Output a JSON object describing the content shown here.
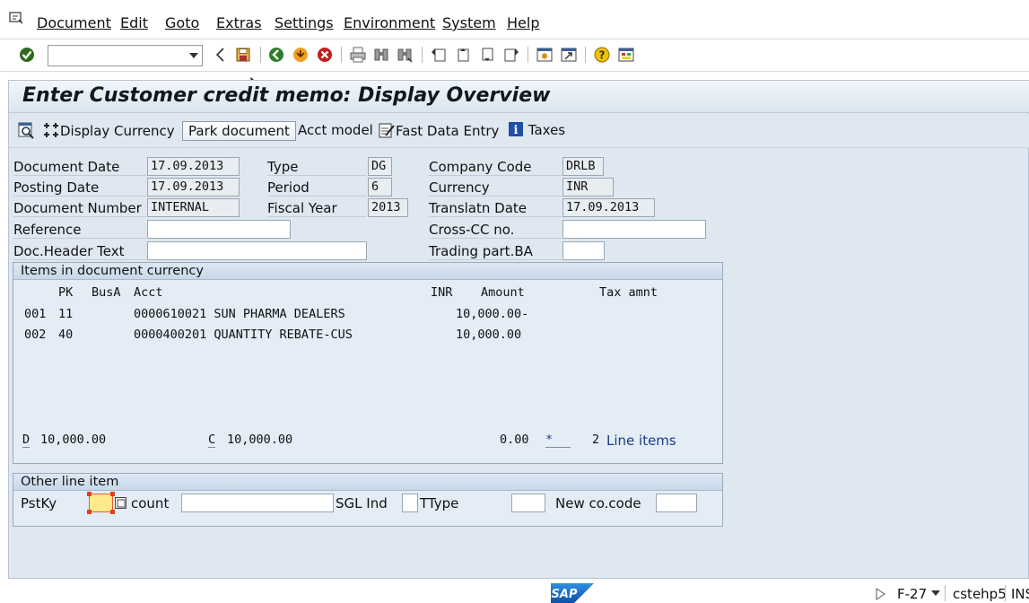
{
  "menu": {
    "items": [
      {
        "label": "Document"
      },
      {
        "label": "Edit"
      },
      {
        "label": "Goto"
      },
      {
        "label": "Extras"
      },
      {
        "label": "Settings"
      },
      {
        "label": "Environment"
      },
      {
        "label": "System"
      },
      {
        "label": "Help"
      }
    ]
  },
  "toolbar": {
    "command_value": "",
    "icons": [
      "enter-check-icon",
      "back-arrow-icon",
      "save-icon",
      "back-icon",
      "exit-icon",
      "cancel-icon",
      "print-icon",
      "find-icon",
      "find-next-icon",
      "first-page-icon",
      "previous-page-icon",
      "next-page-icon",
      "last-page-icon",
      "create-session-icon",
      "shortcut-icon",
      "help-icon",
      "customize-layout-icon"
    ]
  },
  "page": {
    "title": "Enter Customer credit memo: Display Overview"
  },
  "app_toolbar": {
    "display_currency": "Display Currency",
    "park_document": "Park document",
    "acct_model": "Acct model",
    "fast_data_entry": "Fast Data Entry",
    "taxes": "Taxes"
  },
  "header": {
    "document_date_label": "Document Date",
    "document_date": "17.09.2013",
    "posting_date_label": "Posting Date",
    "posting_date": "17.09.2013",
    "document_number_label": "Document Number",
    "document_number": "INTERNAL",
    "reference_label": "Reference",
    "reference": "",
    "doc_header_text_label": "Doc.Header Text",
    "doc_header_text": "",
    "type_label": "Type",
    "type": "DG",
    "period_label": "Period",
    "period": "6",
    "fiscal_year_label": "Fiscal Year",
    "fiscal_year": "2013",
    "company_code_label": "Company Code",
    "company_code": "DRLB",
    "currency_label": "Currency",
    "currency": "INR",
    "translatn_date_label": "Translatn Date",
    "translatn_date": "17.09.2013",
    "cross_cc_label": "Cross-CC no.",
    "cross_cc": "",
    "trading_part_label": "Trading part.BA",
    "trading_part": ""
  },
  "items": {
    "title": "Items in document currency",
    "columns": {
      "pk": "PK",
      "busa": "BusA",
      "acct": "Acct",
      "cur": "INR",
      "amount": "Amount",
      "tax": "Tax amnt"
    },
    "rows": [
      {
        "no": "001",
        "pk": "11",
        "acct": "0000610021 SUN PHARMA DEALERS",
        "amount": "10,000.00-"
      },
      {
        "no": "002",
        "pk": "40",
        "acct": "0000400201 QUANTITY REBATE-CUS",
        "amount": "10,000.00"
      }
    ],
    "debit_label": "D",
    "debit_total": "10,000.00",
    "credit_label": "C",
    "credit_total": "10,000.00",
    "balance": "0.00",
    "balance_flag": "*",
    "line_items_count": "2",
    "line_items_label": "Line items"
  },
  "other_line": {
    "title": "Other line item",
    "pstky_label": "PstKy",
    "pstky": "",
    "account_label": "count",
    "account": "",
    "sgl_label": "SGL Ind",
    "sgl": "",
    "ttype_label": "TType",
    "ttype": "",
    "new_cocode_label": "New co.code",
    "new_cocode": ""
  },
  "status": {
    "transaction": "F-27",
    "server": "cstehp5",
    "mode": "INS"
  },
  "brand": {
    "logo": "SAP"
  }
}
